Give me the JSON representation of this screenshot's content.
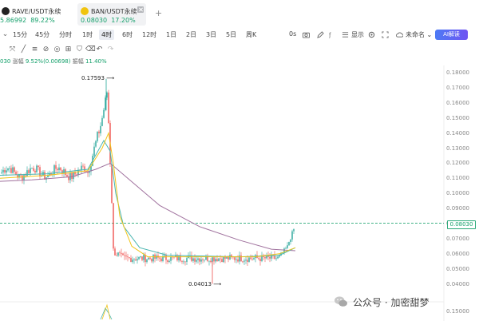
{
  "tabs": [
    {
      "title": "RAVE/USDT永续",
      "price": "5.86992",
      "change": "89.22%",
      "icon_color": "#222222"
    },
    {
      "title": "BAN/USDT永续",
      "price": "0.08030",
      "change": "17.20%",
      "icon_color": "#f1c40f"
    }
  ],
  "toolbar": {
    "intervals": [
      "15分",
      "45分",
      "分时",
      "1时",
      "4时",
      "6时",
      "12时",
      "1日",
      "2日",
      "3日",
      "5日",
      "周K"
    ],
    "active_interval": "4时",
    "clock_label": "0s",
    "settings_label": "显示",
    "unnamed_label": "未命名",
    "ai_label": "AI解读"
  },
  "stats": {
    "prefix": "030",
    "change_label": "涨幅",
    "change_value": "9.52%(0.00698)",
    "amp_label": "振幅",
    "amp_value": "11.40%"
  },
  "chart": {
    "current_price": "0.08030",
    "high_label": "0.17593",
    "low_label": "0.04013",
    "ticks": [
      "0.18000",
      "0.17000",
      "0.16000",
      "0.15000",
      "0.14000",
      "0.13000",
      "0.12000",
      "0.11000",
      "0.10000",
      "0.09000",
      "0.08000",
      "0.07000",
      "0.06000",
      "0.05000",
      "0.04000"
    ],
    "bottom_tick": "0.15000",
    "up_color": "#26a69a",
    "down_color": "#ef5350",
    "ma_yellow": "#f0c419",
    "ma_teal": "#49b5b0",
    "ma_purple": "#a0729e"
  },
  "watermark": {
    "text": "公众号 · 加密甜梦"
  }
}
